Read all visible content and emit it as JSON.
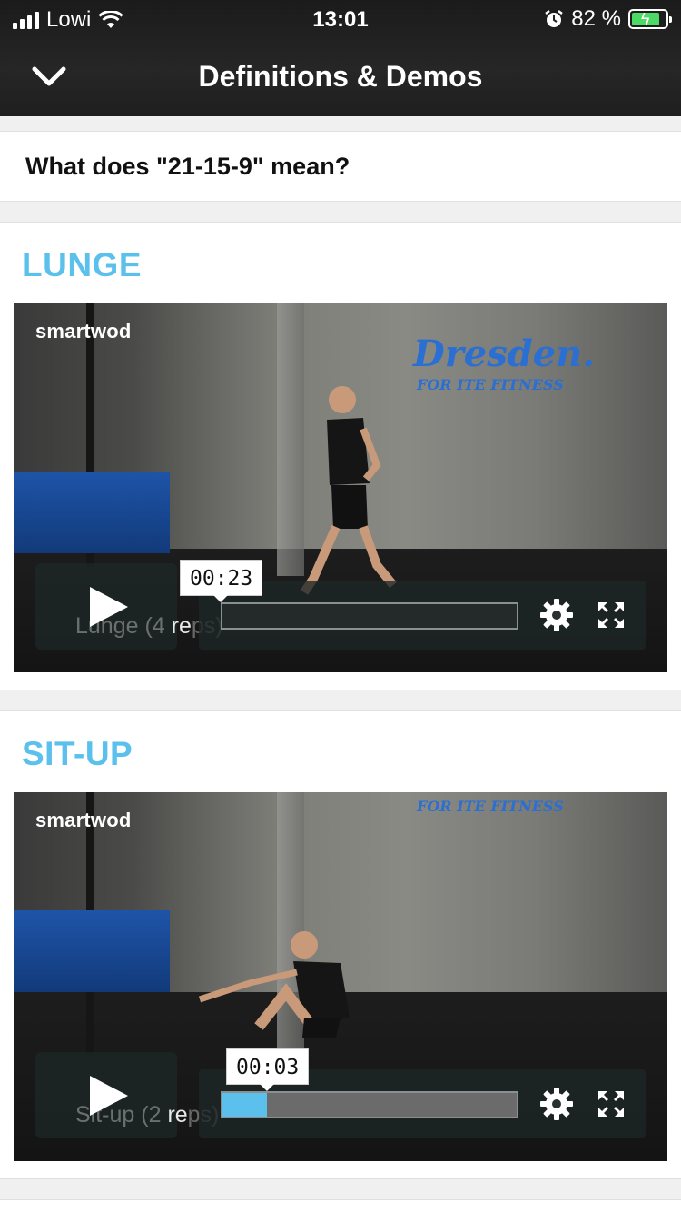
{
  "status_bar": {
    "carrier": "Lowi",
    "time": "13:01",
    "battery_percent": "82 %",
    "battery_level": 0.82,
    "icons": [
      "signal-icon",
      "wifi-icon",
      "alarm-icon",
      "battery-charging-icon"
    ]
  },
  "nav": {
    "back_icon": "chevron-down-icon",
    "title": "Definitions & Demos"
  },
  "question": {
    "label": "What does \"21-15-9\" mean?"
  },
  "exercises": [
    {
      "title": "LUNGE",
      "watermark": "smartwod",
      "caption_dim": "Lunge (4 ",
      "caption_bright": "re",
      "caption_tail": "ps)",
      "tooltip_time": "00:23",
      "progress": 0.0,
      "graffiti_main": "Dresden.",
      "graffiti_sub": "FOR      ITE FITNESS"
    },
    {
      "title": "SIT-UP",
      "watermark": "smartwod",
      "caption_dim": "Sit-up (2 ",
      "caption_bright": "re",
      "caption_tail": "ps)",
      "tooltip_time": "00:03",
      "progress": 0.15,
      "graffiti_sub": "FOR      ITE FITNESS"
    }
  ],
  "colors": {
    "accent": "#5bc1ec",
    "header_bg": "#222222",
    "page_bg": "#f0f0f0"
  }
}
